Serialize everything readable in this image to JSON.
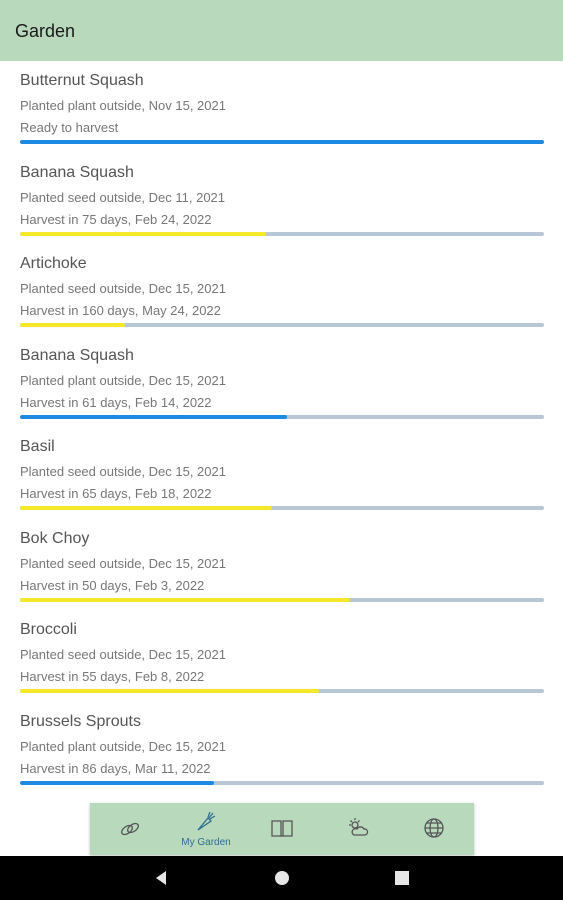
{
  "appbar": {
    "title": "Garden"
  },
  "colors": {
    "ready": "#1e88e5",
    "seed": "#f5e82a",
    "plant": "#1e88e5",
    "track": "#b7c7d6",
    "nav_bg": "#b9d9bd",
    "header_bg": "#b9d9bd"
  },
  "items": [
    {
      "name": "Butternut Squash",
      "planted": "Planted plant outside, Nov 15, 2021",
      "status": "Ready to harvest",
      "progress": 1.0,
      "color": "#1e88e5"
    },
    {
      "name": "Banana Squash",
      "planted": "Planted seed outside, Dec 11, 2021",
      "status": "Harvest in 75 days, Feb 24, 2022",
      "progress": 0.47,
      "color": "#f5e82a"
    },
    {
      "name": "Artichoke",
      "planted": "Planted seed outside, Dec 15, 2021",
      "status": "Harvest in 160 days, May 24, 2022",
      "progress": 0.2,
      "color": "#f5e82a"
    },
    {
      "name": "Banana Squash",
      "planted": "Planted plant outside, Dec 15, 2021",
      "status": "Harvest in 61 days, Feb 14, 2022",
      "progress": 0.51,
      "color": "#1e88e5"
    },
    {
      "name": "Basil",
      "planted": "Planted seed outside, Dec 15, 2021",
      "status": "Harvest in 65 days, Feb 18, 2022",
      "progress": 0.48,
      "color": "#f5e82a"
    },
    {
      "name": "Bok Choy",
      "planted": "Planted seed outside, Dec 15, 2021",
      "status": "Harvest in 50 days, Feb 3, 2022",
      "progress": 0.63,
      "color": "#f5e82a"
    },
    {
      "name": "Broccoli",
      "planted": "Planted seed outside, Dec 15, 2021",
      "status": "Harvest in 55 days, Feb 8, 2022",
      "progress": 0.57,
      "color": "#f5e82a"
    },
    {
      "name": "Brussels Sprouts",
      "planted": "Planted plant outside, Dec 15, 2021",
      "status": "Harvest in 86 days, Mar 11, 2022",
      "progress": 0.37,
      "color": "#1e88e5"
    }
  ],
  "bottom_nav": [
    {
      "id": "seeds",
      "icon": "seeds-icon",
      "label": "",
      "active": false
    },
    {
      "id": "my-garden",
      "icon": "carrot-icon",
      "label": "My Garden",
      "active": true
    },
    {
      "id": "guide",
      "icon": "book-icon",
      "label": "",
      "active": false
    },
    {
      "id": "weather",
      "icon": "partly-cloudy-icon",
      "label": "",
      "active": false
    },
    {
      "id": "globe",
      "icon": "globe-icon",
      "label": "",
      "active": false
    }
  ],
  "system_nav": [
    {
      "id": "back",
      "icon": "back-triangle-icon"
    },
    {
      "id": "home",
      "icon": "home-circle-icon"
    },
    {
      "id": "recents",
      "icon": "recents-square-icon"
    }
  ]
}
